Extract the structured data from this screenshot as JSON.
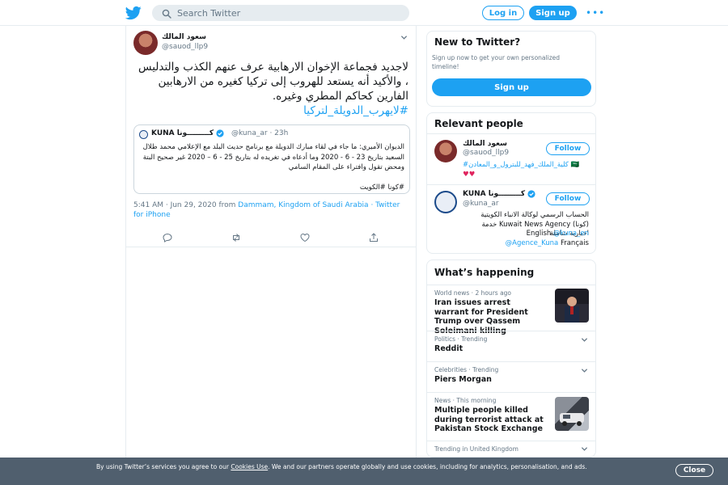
{
  "header": {
    "search_placeholder": "Search Twitter",
    "login_label": "Log in",
    "signup_label": "Sign up",
    "more_label": "•••"
  },
  "tweet": {
    "author_name": "سعود المالك",
    "author_handle": "@sauod_llp9",
    "text": "لاجديد فجماعة الإخوان الارهابية عرف عنهم الكذب والتدليس ، والأكيد أنه يستعد للهروب إلى تركيا كغيره من الارهابين الفارين كحاكم المطري وغيره.",
    "hashtag": "#لايهرب_الدويلة_لتركيا",
    "quoted": {
      "name": "KUNA كـــــــــونا",
      "handle": "@kuna_ar",
      "time": "· 23h",
      "text": "الديوان الأميري: ما جاء في لقاء مبارك الدويلة مع برنامج حديث البلد مع الإعلامي محمد طلال السعيد بتاريخ 23 - 6 - 2020 وما أدعاه في تغريده له بتاريخ 25 - 6 – 2020 غير صحيح البتة ومحض تقول وافتراء على المقام السامي",
      "hashtag": "#كونا #الكويت"
    },
    "timestamp": "5:41 AM · Jun 29, 2020 from",
    "location": "Dammam, Kingdom of Saudi Arabia",
    "source": "· Twitter for iPhone"
  },
  "new_to_twitter": {
    "title": "New to Twitter?",
    "description": "Sign up now to get your own personalized timeline!",
    "signup_label": "Sign up"
  },
  "relevant_people": {
    "title": "Relevant people",
    "people": [
      {
        "name": "سعود المالك",
        "handle": "@sauod_llp9",
        "follow_label": "Follow",
        "bio_link": "#كلية_الملك_فهد_للبترول_و_المعادن",
        "bio_flag": "🇸🇦",
        "bio_hearts": "♥♥"
      },
      {
        "name": "KUNA كـــــــــونا",
        "handle": "@kuna_ar",
        "follow_label": "Follow",
        "bio_ar": "الحساب الرسمي لوكالة الانباء الكويتية (كونا) Kuwait News Agency خدمة اخبارية شاملة",
        "bio_en_label": "English",
        "bio_en_link": "@kuna_en",
        "bio_fr_link": "@Agence_Kuna",
        "bio_fr_label": "Français"
      }
    ]
  },
  "whats_happening": {
    "title": "What’s happening",
    "items": [
      {
        "context": "World news · 2 hours ago",
        "title": "Iran issues arrest warrant for President Trump over Qassem Soleimani killing"
      },
      {
        "context": "Politics · Trending",
        "title": "Reddit"
      },
      {
        "context": "Celebrities · Trending",
        "title": "Piers Morgan"
      },
      {
        "context": "News · This morning",
        "title": "Multiple people killed during terrorist attack at Pakistan Stock Exchange"
      },
      {
        "context": "Trending in United Kingdom",
        "title": ""
      }
    ]
  },
  "cookie_banner": {
    "text_before": "By using Twitter’s services you agree to our",
    "link": "Cookies Use",
    "text_after": ". We and our partners operate globally and use cookies, including for analytics, personalisation, and ads.",
    "close_label": "Close"
  },
  "colors": {
    "brand": "#1da1f2",
    "text": "#14171a",
    "muted": "#657786",
    "border": "#e6ecf0",
    "banner": "#505f6e"
  }
}
